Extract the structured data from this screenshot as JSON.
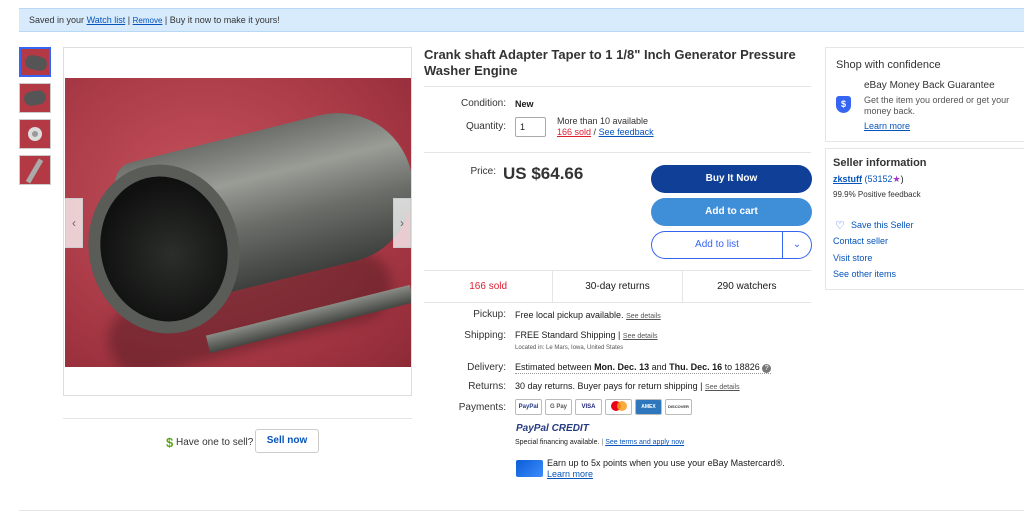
{
  "banner": {
    "saved_prefix": "Saved in your",
    "watch_list": "Watch list",
    "separator": "|",
    "remove": "Remove",
    "suffix": "| Buy it now to make it yours!"
  },
  "gallery": {
    "thumbnails": [
      "tube-photo-1",
      "tube-photo-2",
      "ring-photo",
      "rod-photo"
    ],
    "prev_arrow": "‹",
    "next_arrow": "›"
  },
  "sell": {
    "dollar": "$",
    "have_one": "Have one to sell?",
    "sell_now": "Sell now"
  },
  "listing": {
    "title": "Crank shaft Adapter Taper to 1 1/8\" Inch Generator Pressure Washer Engine",
    "condition_label": "Condition:",
    "condition_value": "New",
    "quantity_label": "Quantity:",
    "quantity_value": "1",
    "available": "More than 10 available",
    "sold": "166 sold",
    "slash": "/",
    "see_feedback": "See feedback",
    "price_label": "Price:",
    "price": "US $64.66",
    "buy_it_now": "Buy It Now",
    "add_to_cart": "Add to cart",
    "add_to_list": "Add to list",
    "dropdown": "⌄"
  },
  "stats": {
    "sold": "166 sold",
    "returns": "30-day returns",
    "watchers": "290 watchers"
  },
  "details": {
    "pickup_label": "Pickup:",
    "pickup_value": "Free local pickup available.",
    "see_details": "See details",
    "shipping_label": "Shipping:",
    "shipping_value": "FREE  Standard Shipping |",
    "located_label": "Located in:",
    "located_value": "Le Mars, Iowa, United States",
    "delivery_label": "Delivery:",
    "delivery_prefix": "Estimated between",
    "delivery_start": "Mon. Dec. 13",
    "delivery_and": "and",
    "delivery_end": "Thu. Dec. 16",
    "delivery_to": "to 18826",
    "info_icon": "?",
    "returns_label": "Returns:",
    "returns_value": "30 day returns. Buyer pays for return shipping |",
    "payments_label": "Payments:",
    "payment_methods": [
      "PayPal",
      "G Pay",
      "VISA",
      "MC",
      "AMEX",
      "DISCOVER"
    ],
    "paypal_credit": "PayPal CREDIT",
    "special_financing": "Special financing available.",
    "see_terms": "See terms and apply now",
    "mastercard_text": "Earn up to 5x points when you use your eBay Mastercard®.",
    "learn_more": "Learn more"
  },
  "confidence": {
    "title": "Shop with confidence",
    "guarantee_title": "eBay Money Back Guarantee",
    "guarantee_text": "Get the item you ordered or get your money back.",
    "learn_more": "Learn more"
  },
  "seller": {
    "title": "Seller information",
    "name": "zkstuff",
    "score": "(53152",
    "star": "★",
    "score_close": ")",
    "positive": "99.9% Positive feedback",
    "save_seller": "Save this Seller",
    "contact": "Contact seller",
    "visit_store": "Visit store",
    "other_items": "See other items"
  },
  "colors": {
    "accent": "#3665f3",
    "buy_button": "#0f3f96",
    "cart_button": "#3f8ed8",
    "banner": "#d7ebfd",
    "sold_red": "#dd1e31"
  }
}
